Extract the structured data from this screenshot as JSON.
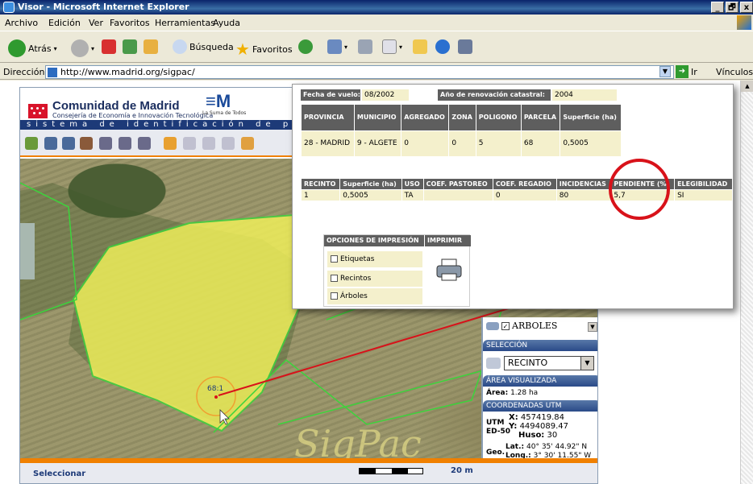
{
  "window": {
    "title": "Visor - Microsoft Internet Explorer",
    "controls": [
      "_",
      "🗗",
      "x"
    ]
  },
  "menu": [
    "Archivo",
    "Edición",
    "Ver",
    "Favoritos",
    "Herramientas",
    "Ayuda"
  ],
  "toolbar": {
    "back": "Atrás",
    "search": "Búsqueda",
    "favorites": "Favoritos"
  },
  "address": {
    "label": "Dirección",
    "url": "http://www.madrid.org/sigpac/",
    "go": "Ir",
    "links": "Vínculos"
  },
  "banner": {
    "org": "Comunidad de Madrid",
    "dept": "Consejería de Economía e Innovación Tecnológica",
    "slogan": "La Suma de Todos",
    "stripe": "sistema de identificación de pa"
  },
  "map": {
    "label": "68:1",
    "watermark": "SigPac"
  },
  "panel": {
    "layer_label": "ARBOLES",
    "selection_header": "SELECCIÓN",
    "selection_value": "RECINTO",
    "area_header": "ÁREA VISUALIZADA",
    "area_label": "Área:",
    "area_value": "1.28 ha",
    "coords_header": "COORDENADAS UTM",
    "utm_label": "UTM",
    "datum_label": "ED-50",
    "x_label": "X:",
    "x_value": "457419.84",
    "y_label": "Y:",
    "y_value": "4494089.47",
    "huso_label": "Huso:",
    "huso_value": "30",
    "geo_label": "Geo.",
    "lat_label": "Lat.:",
    "lat_value": "40° 35' 44.92\" N",
    "long_label": "Long.:",
    "long_value": "3° 30' 11.55\" W"
  },
  "popup": {
    "flight_label": "Fecha de vuelo:",
    "flight_value": "08/2002",
    "renewal_label": "Año de renovación catastral:",
    "renewal_value": "2004",
    "parcel_headers": [
      "PROVINCIA",
      "MUNICIPIO",
      "AGREGADO",
      "ZONA",
      "POLIGONO",
      "PARCELA",
      "Superficie (ha)"
    ],
    "parcel_row": [
      "28 - MADRID",
      "9 - ALGETE",
      "0",
      "0",
      "5",
      "68",
      "0,5005"
    ],
    "recinto_headers": [
      "RECINTO",
      "Superficie (ha)",
      "USO",
      "COEF. PASTOREO",
      "COEF. REGADIO",
      "INCIDENCIAS",
      "PENDIENTE (%)",
      "ELEGIBILIDAD"
    ],
    "recinto_row": [
      "1",
      "0,5005",
      "TA",
      "",
      "0",
      "80",
      "5,7",
      "SI"
    ],
    "print_header": "OPCIONES DE IMPRESIÓN",
    "print_button_header": "IMPRIMIR",
    "print_options": [
      "Etiquetas",
      "Recintos",
      "Árboles"
    ]
  },
  "statusbar": {
    "mode": "Seleccionar",
    "scale": "20 m"
  },
  "colors": {
    "parcel_fill": "#f2f25a",
    "annotation": "#d8121a",
    "brand_blue": "#1d3a78",
    "accent": "#f08000"
  }
}
